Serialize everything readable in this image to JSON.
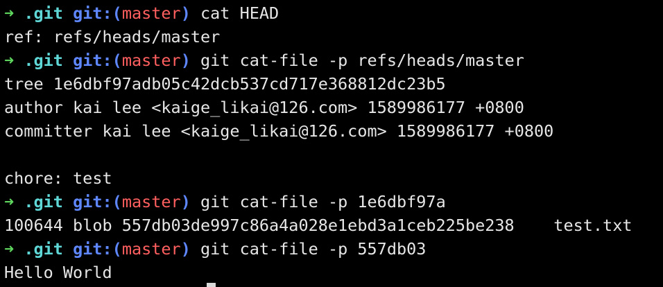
{
  "colors": {
    "background": "#000000",
    "text": "#e6e6e6",
    "prompt_arrow": "#5fd75f",
    "prompt_dir": "#5fd7d7",
    "prompt_git": "#5f87ff",
    "prompt_branch": "#ff5f5f"
  },
  "prompt": {
    "arrow": "➜",
    "dir": ".git",
    "git_label": "git:(",
    "branch": "master",
    "close_paren": ")"
  },
  "lines": [
    {
      "type": "prompt",
      "command": "cat HEAD"
    },
    {
      "type": "output",
      "text": "ref: refs/heads/master"
    },
    {
      "type": "prompt",
      "command": "git cat-file -p refs/heads/master"
    },
    {
      "type": "output",
      "text": "tree 1e6dbf97adb05c42dcb537cd717e368812dc23b5"
    },
    {
      "type": "output",
      "text": "author kai lee <kaige_likai@126.com> 1589986177 +0800"
    },
    {
      "type": "output",
      "text": "committer kai lee <kaige_likai@126.com> 1589986177 +0800"
    },
    {
      "type": "output",
      "text": ""
    },
    {
      "type": "output",
      "text": "chore: test"
    },
    {
      "type": "prompt",
      "command": "git cat-file -p 1e6dbf97a"
    },
    {
      "type": "output",
      "text": "100644 blob 557db03de997c86a4a028e1ebd3a1ceb225be238    test.txt"
    },
    {
      "type": "prompt",
      "command": "git cat-file -p 557db03"
    },
    {
      "type": "output",
      "text": "Hello World"
    }
  ]
}
